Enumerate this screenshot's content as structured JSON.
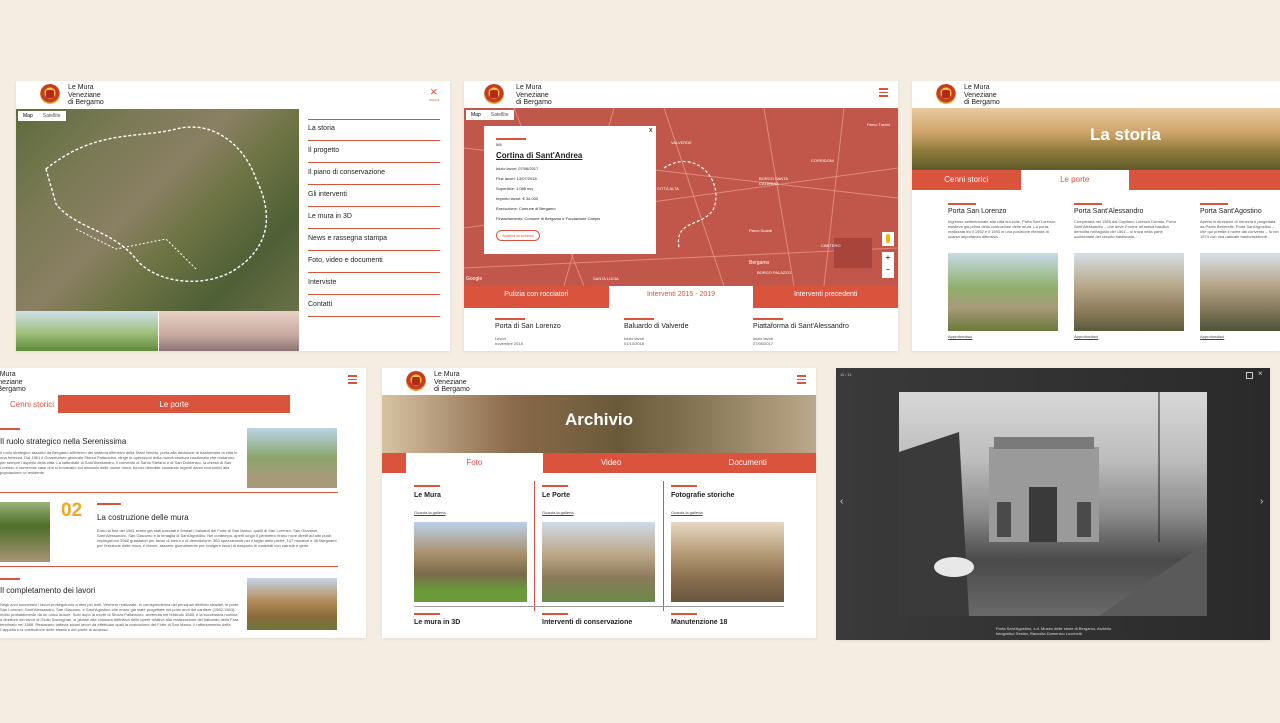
{
  "brand": {
    "line1": "Le Mura",
    "line2": "Veneziane",
    "line3": "di Bergamo"
  },
  "card1": {
    "map_tabs": [
      "Map",
      "Satellite"
    ],
    "close_label": "CHIUDI",
    "menu": [
      "La storia",
      "Il progetto",
      "Il piano di conservazione",
      "Gli interventi",
      "Le mura in 3D",
      "News e rassegna stampa",
      "Foto, video e documenti",
      "Interviste",
      "Contatti"
    ]
  },
  "card2": {
    "map_tabs": [
      "Map",
      "Satellite"
    ],
    "popup": {
      "count": "5/8",
      "title": "Cortina di Sant'Andrea",
      "inizio": "Inizio lavori: 07/06/2017",
      "fine": "Fine lavori: 13/07/2018",
      "superficie": "Superficie: 1.085 mq",
      "importo": "Importo lavori: € 34.000",
      "esecuzione": "Esecuzione: Comune di Bergamo",
      "finanziamento": "Finanziamento: Comune di Bergamo e Fondazione Cariplo",
      "button": "Scarica la scheda",
      "close": "x"
    },
    "map_labels": [
      "VALVERDE",
      "CORRIDONI",
      "BORGO SANTA CATERINA",
      "CITTÀ ALTA",
      "Parco Turani",
      "Parco Suardi",
      "CIMITERO",
      "Bergamo",
      "BORGO PALAZZO",
      "SANTA LUCIA",
      "Google"
    ],
    "tabs": [
      "Pulizia con rocciatori",
      "Interventi 2015 - 2019",
      "Interventi precedenti"
    ],
    "items": [
      {
        "title": "Porta di San Lorenzo",
        "meta1": "Lavori",
        "meta2": "novembre 2018"
      },
      {
        "title": "Baluardo di Valverde",
        "meta1": "Inizio lavori",
        "meta2": "01/10/2018"
      },
      {
        "title": "Piattaforma di Sant'Alessandro",
        "meta1": "Inizio lavori",
        "meta2": "07/06/2017"
      }
    ]
  },
  "card3": {
    "hero": "La storia",
    "tabs": [
      "Cenni storici",
      "Le porte"
    ],
    "cols": [
      {
        "title": "Porta San Lorenzo",
        "text": "Ingresso settentrionale alla città sul colle, Porta San Lorenzo esisteva già prima della costruzione delle mura. La porta, realizzata tra il 1592 e il 1593 in una posizione ritenuta di scarsa importanza difensiva...",
        "link": "Approfondisci"
      },
      {
        "title": "Porta Sant'Alessandro",
        "text": "Completata nel 1565 dal Capitano Lorenzo Donato, Porta Sant'Alessandro – che deve il nome all'antica basilica demolita nell'agosto del 1561 – si trova nella parte occidentale del circuito bastionato...",
        "link": "Approfondisci"
      },
      {
        "title": "Porta Sant'Agostino",
        "text": "Aperta in direzione di Venezia e progettata da Paolo Berlendis, Porta Sant'Agostino – che qui prende il nome dal convento – fu nel 1574 con una radicale trasformazione...",
        "link": "Approfondisci"
      }
    ]
  },
  "card4": {
    "tabs": [
      "Cenni storici",
      "Le porte"
    ],
    "sec1_title": "Il ruolo strategico nella Serenissima",
    "sec1_text": "Il ruolo strategico assunto da Bergamo all'interno del sistema difensivo della Stato veneto, porta alla decisione di trasformare la città in una fortezza. Dal 1561 il Governatore generale Sforza Pallavicino, dirige le operazioni della nuova struttura bastionata che mutarono per sempre l'aspetto della città. La cattedrale di Sant'Alessandro, il convento di Santo Stefano e di San Domenico, la chiesa di San Lorenzo e numerose case che si trovavano sul tracciato delle nuove mura, furono demolite causando ingenti danni economici alla popolazione ivi residente.",
    "num": "02",
    "sec2_title": "La costruzione delle mura",
    "sec2_text": "Entro la fine del 1561 erano già stati tracciati e fondati i baluardi del Forte di San Marco, quelli di San Lorenzo, San Giovanni, Sant'Alessandro, San Giacomo e la tenaglia di Sant'Agostino. Nel contempo, aperti lungo il perimetro erano nove diretti ad altri punti, impiegarono 3960 guastatori per lavori di sterro e di demolizione, 363 spezzamonti per il taglio delle pietre, 147 muratori e 46 falegnami per l'erezione delle mura, e donne, assunte giornalmente per svolgere lavori di trasporto di materiali con carriole e gerle.",
    "sec3_title": "Il completamento dei lavori",
    "sec3_text": "Negli anni successivi i lavori proseguirono a ritmi più lenti. Vennero realizzate, in corrispondenza dei principali direttrici stradali, le porte San Lorenzo, Sant'Alessandro, San Giacomo, e Sant'Agostino che erano già state progettate nei primi anni del cantiere (1562-1563), molto probabilmente da un unico autore. Solo dopo la morte di Sforza Pallavicino, avvenuta nel febbraio 1585, e la successiva nomina a direttore dei lavori di Giulio Savorgnan, si giunse alla chiusura definitiva delle opere relative alla realizzazione del baluardo della Fara, terminato nel 1588. Restavano tuttavia alcuni lavori da effettuare quali la costruzione del Forte di San Marco, il rafforzamento della Cappella e la costruzione delle strade e del ponte di accesso."
  },
  "card5": {
    "hero": "Archivio",
    "tabs": [
      "Foto",
      "Video",
      "Documenti"
    ],
    "galleries": [
      {
        "title": "Le Mura",
        "link": "Guarda la galleria"
      },
      {
        "title": "Le Porte",
        "link": "Guarda la galleria"
      },
      {
        "title": "Fotografie storiche",
        "link": "Guarda la galleria"
      }
    ],
    "next": [
      "Le mura in 3D",
      "Interventi di conservazione",
      "Manutenzione 18"
    ]
  },
  "card6": {
    "counter": "11 / 11",
    "prev": "‹",
    "next": "›",
    "caption1": "Porta Sant'Agostino, s.d. Museo delle storie di Bergamo, Archivio",
    "caption2": "fotografico Sestini, Raccolta Domenico Lucchetti"
  },
  "colors": {
    "accent": "#d9533d",
    "background": "#f5ede2",
    "map_red": "#c0574a"
  }
}
